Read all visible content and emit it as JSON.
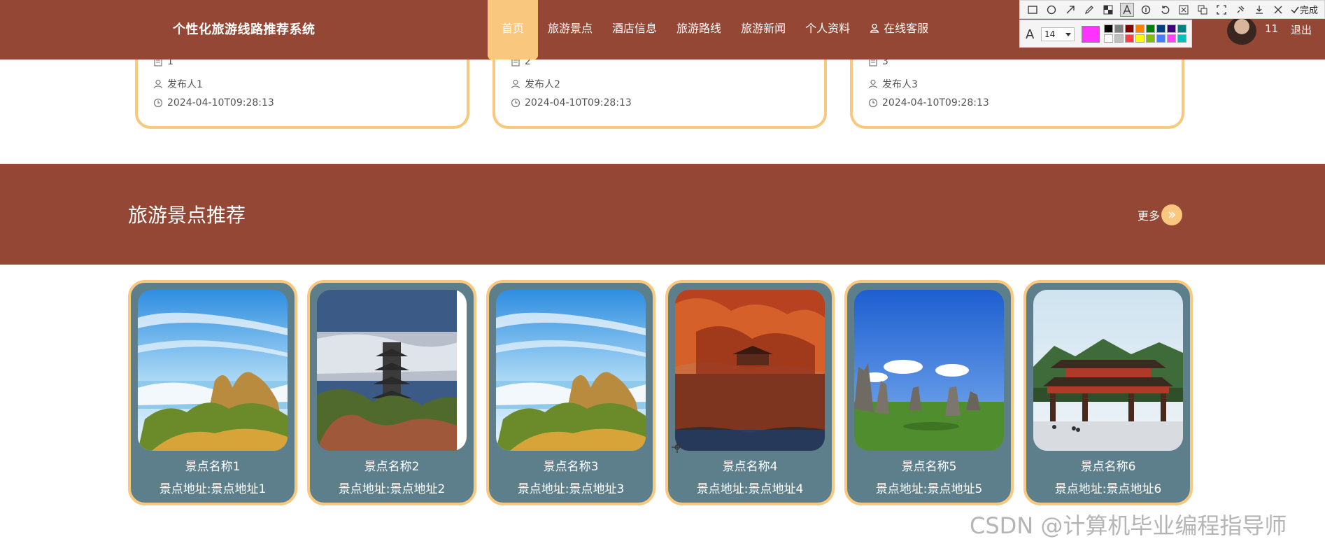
{
  "header": {
    "brand": "个性化旅游线路推荐系统",
    "nav": [
      {
        "label": "首页",
        "active": true
      },
      {
        "label": "旅游景点"
      },
      {
        "label": "酒店信息"
      },
      {
        "label": "旅游路线"
      },
      {
        "label": "旅游新闻"
      },
      {
        "label": "个人资料"
      },
      {
        "label": "在线客服",
        "icon": "person-icon"
      }
    ],
    "user": "11",
    "logout": "退出"
  },
  "snip_toolbar": {
    "font_size": "14",
    "current_color": "#ff33ff",
    "done_label": "完成",
    "palette": [
      "#000000",
      "#808080",
      "#800000",
      "#ff8000",
      "#008000",
      "#004080",
      "#400080",
      "#008080",
      "#ffffff",
      "#c0c0c0",
      "#ff4040",
      "#ffff00",
      "#80c000",
      "#4080ff",
      "#ff40ff",
      "#00c0c0"
    ]
  },
  "news_cards": [
    {
      "number": "1",
      "publisher": "发布人1",
      "time": "2024-04-10T09:28:13"
    },
    {
      "number": "2",
      "publisher": "发布人2",
      "time": "2024-04-10T09:28:13"
    },
    {
      "number": "3",
      "publisher": "发布人3",
      "time": "2024-04-10T09:28:13"
    }
  ],
  "recommend": {
    "title": "旅游景点推荐",
    "more": "更多"
  },
  "spots": [
    {
      "name": "景点名称1",
      "address": "景点地址:景点地址1",
      "scene": "mountain-sea"
    },
    {
      "name": "景点名称2",
      "address": "景点地址:景点地址2",
      "scene": "pagoda"
    },
    {
      "name": "景点名称3",
      "address": "景点地址:景点地址3",
      "scene": "mountain-sea"
    },
    {
      "name": "景点名称4",
      "address": "景点地址:景点地址4",
      "scene": "autumn-lake"
    },
    {
      "name": "景点名称5",
      "address": "景点地址:景点地址5",
      "scene": "stone-forest"
    },
    {
      "name": "景点名称6",
      "address": "景点地址:景点地址6",
      "scene": "gate"
    }
  ],
  "watermark": "CSDN @计算机毕业编程指导师",
  "colors": {
    "brand": "#944734",
    "accent": "#f9c77d",
    "card": "#5d7f8c"
  }
}
